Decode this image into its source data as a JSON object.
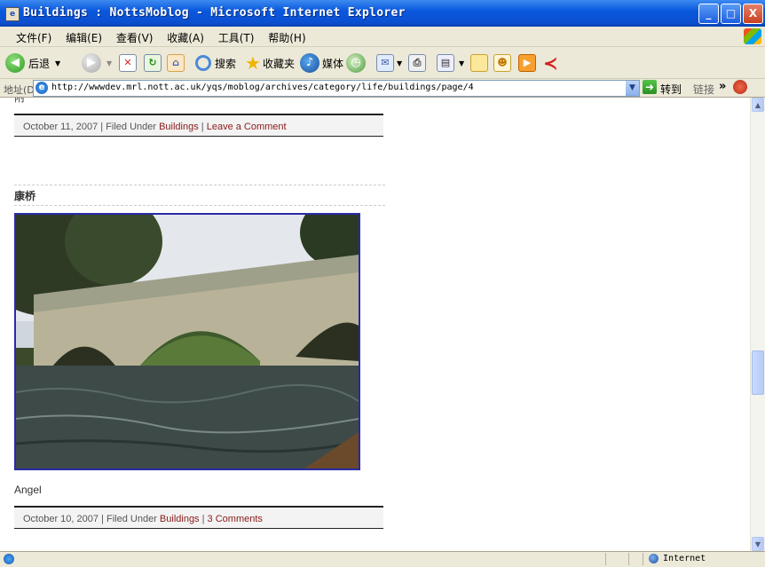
{
  "window": {
    "title": "Buildings : NottsMoblog - Microsoft Internet Explorer",
    "buttons": {
      "minimize": "_",
      "maximize": "□",
      "close": "X"
    }
  },
  "menu": [
    "文件(F)",
    "编辑(E)",
    "查看(V)",
    "收藏(A)",
    "工具(T)",
    "帮助(H)"
  ],
  "toolbar": {
    "back_label": "后退",
    "search_label": "搜索",
    "favorites_label": "收藏夹",
    "media_label": "媒体"
  },
  "address": {
    "label": "地址(D)",
    "url": "http://wwwdev.mrl.nott.ac.uk/yqs/moblog/archives/category/life/buildings/page/4",
    "go_label": "转到",
    "links_label": "链接"
  },
  "content": {
    "cut_text": "附",
    "posts": [
      {
        "date": "October 11, 2007",
        "filed_under": "Filed Under",
        "category": "Buildings",
        "comments": "Leave a Comment",
        "sep": "|"
      },
      {
        "title": "康桥",
        "caption": "Angel",
        "date": "October 10, 2007",
        "filed_under": "Filed Under",
        "category": "Buildings",
        "comments": "3 Comments",
        "sep": "|"
      }
    ]
  },
  "status": {
    "zone": "Internet"
  }
}
